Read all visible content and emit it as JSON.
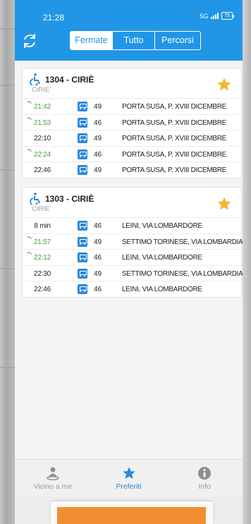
{
  "status_bar": {
    "time": "21:28",
    "network": "5G",
    "battery": "75"
  },
  "header": {
    "tabs": [
      {
        "label": "Fermate",
        "active": true
      },
      {
        "label": "Tutto",
        "active": false
      },
      {
        "label": "Percorsi",
        "active": false
      }
    ]
  },
  "stops": [
    {
      "code_name": "1304 - CIRIÈ",
      "municipality": "CIRIE'",
      "favorite": true,
      "departures": [
        {
          "time": "21:42",
          "realtime": true,
          "line": "49",
          "destination": "PORTA SUSA, P. XVIII DICEMBRE"
        },
        {
          "time": "21:53",
          "realtime": true,
          "line": "46",
          "destination": "PORTA SUSA, P. XVIII DICEMBRE"
        },
        {
          "time": "22:10",
          "realtime": false,
          "line": "49",
          "destination": "PORTA SUSA, P. XVIII DICEMBRE"
        },
        {
          "time": "22:24",
          "realtime": true,
          "line": "46",
          "destination": "PORTA SUSA, P. XVIII DICEMBRE"
        },
        {
          "time": "22:46",
          "realtime": false,
          "line": "49",
          "destination": "PORTA SUSA, P. XVIII DICEMBRE"
        }
      ]
    },
    {
      "code_name": "1303 - CIRIÈ",
      "municipality": "CIRIE'",
      "favorite": true,
      "departures": [
        {
          "time": "8 min",
          "realtime": false,
          "line": "46",
          "destination": "LEINI, VIA LOMBARDORE"
        },
        {
          "time": "21:57",
          "realtime": true,
          "line": "49",
          "destination": "SETTIMO TORINESE, VIA LOMBARDIA"
        },
        {
          "time": "22:12",
          "realtime": true,
          "line": "46",
          "destination": "LEINI, VIA LOMBARDORE"
        },
        {
          "time": "22:30",
          "realtime": false,
          "line": "49",
          "destination": "SETTIMO TORINESE, VIA LOMBARDIA"
        },
        {
          "time": "22:46",
          "realtime": false,
          "line": "46",
          "destination": "LEINI, VIA LOMBARDORE"
        }
      ]
    }
  ],
  "bottom_nav": [
    {
      "label": "Vicino a me",
      "icon": "person-pin-icon",
      "active": false
    },
    {
      "label": "Preferiti",
      "icon": "star-icon",
      "active": true
    },
    {
      "label": "Info",
      "icon": "info-icon",
      "active": false
    }
  ],
  "colors": {
    "primary": "#2196e6",
    "realtime": "#3fa33b",
    "favorite": "#f5b82e",
    "bus": "#2b89d6",
    "banner": "#f28e32"
  }
}
